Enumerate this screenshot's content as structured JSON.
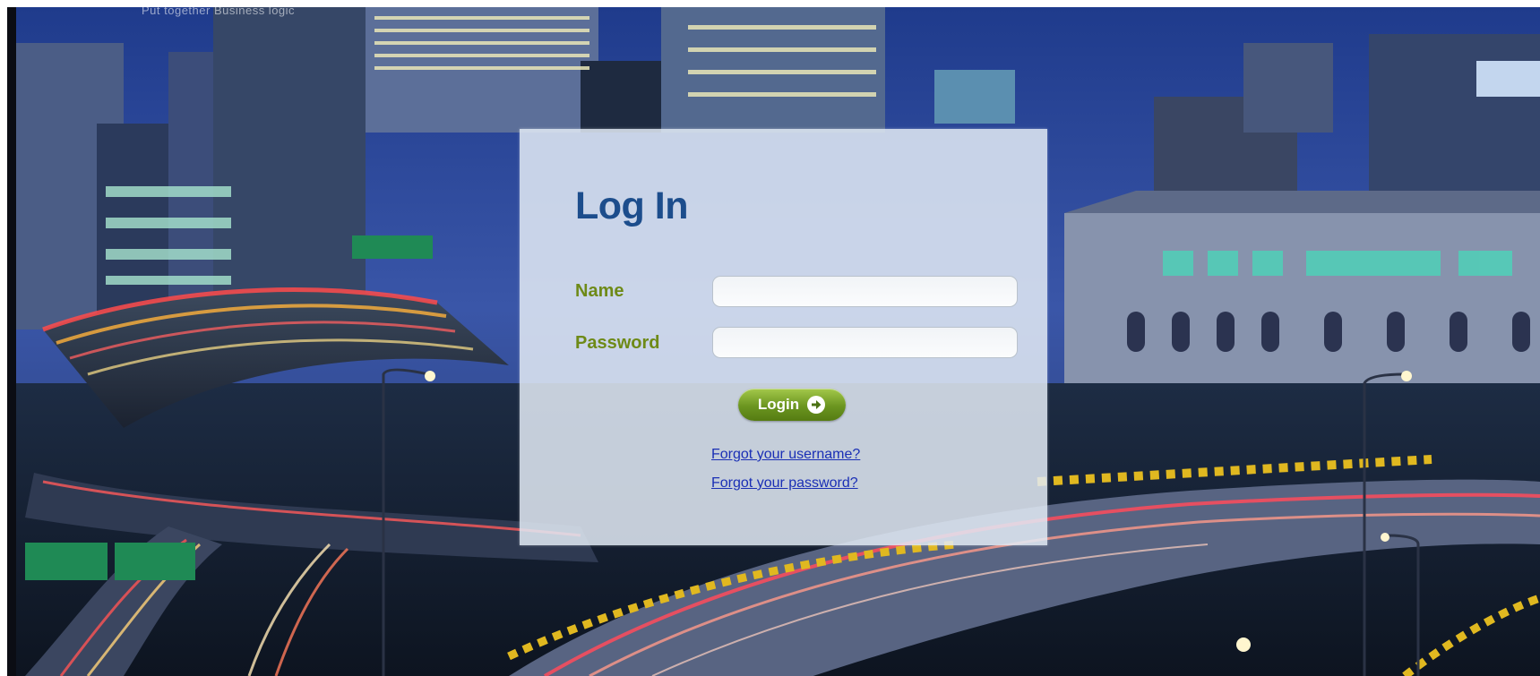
{
  "background": {
    "description_icon": "city-highway-night-photo",
    "caption": "Put together Business logic"
  },
  "login": {
    "title": "Log In",
    "name_label": "Name",
    "name_value": "",
    "password_label": "Password",
    "password_value": "",
    "button_label": "Login",
    "button_icon": "arrow-right-circle-icon",
    "forgot_username": "Forgot your username?",
    "forgot_password": "Forgot your password?"
  },
  "colors": {
    "title": "#1c4d8c",
    "label": "#6e8a17",
    "button": "#6b9520",
    "link": "#1a2fb5"
  }
}
